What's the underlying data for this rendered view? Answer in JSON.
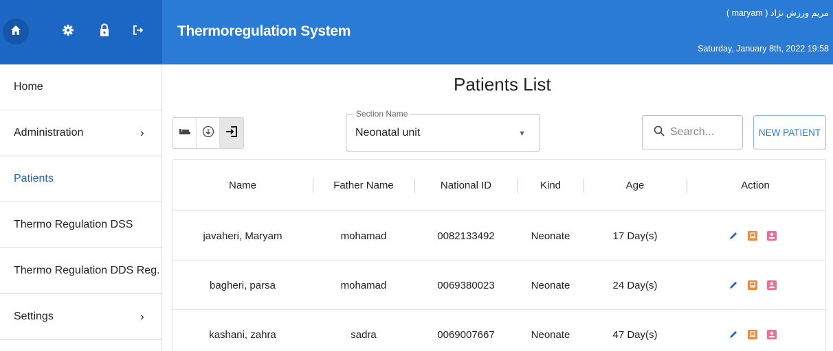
{
  "header": {
    "app_title": "Thermoregulation System",
    "user_name": "مریم ورزش نژاد ( maryam )",
    "date_time": "Saturday, January 8th, 2022 19:58",
    "icons": [
      "home-icon",
      "gear-icon",
      "lock-icon",
      "logout-icon"
    ]
  },
  "sidebar": {
    "items": [
      {
        "label": "Home",
        "has_submenu": false
      },
      {
        "label": "Administration",
        "has_submenu": true
      },
      {
        "label": "Patients",
        "has_submenu": false,
        "active": true
      },
      {
        "label": "Thermo Regulation DSS",
        "has_submenu": false
      },
      {
        "label": "Thermo Regulation DDS Reg.",
        "has_submenu": false
      },
      {
        "label": "Settings",
        "has_submenu": true
      }
    ],
    "chevron": "›"
  },
  "main": {
    "title": "Patients List",
    "toolbar": {
      "icons": [
        "bed-icon",
        "download-circle-icon",
        "login-arrow-icon"
      ]
    },
    "section": {
      "label": "Section Name",
      "value": "Neonatal unit"
    },
    "search": {
      "placeholder": "Search..."
    },
    "new_patient_label": "NEW PATIENT",
    "table": {
      "columns": [
        "Name",
        "Father Name",
        "National ID",
        "Kind",
        "Age",
        "Action"
      ],
      "rows": [
        {
          "name": "javaheri, Maryam",
          "father": "mohamad",
          "national_id": "0082133492",
          "kind": "Neonate",
          "age": "17 Day(s)"
        },
        {
          "name": "bagheri, parsa",
          "father": "mohamad",
          "national_id": "0069380023",
          "kind": "Neonate",
          "age": "24 Day(s)"
        },
        {
          "name": "kashani, zahra",
          "father": "sadra",
          "national_id": "0069007667",
          "kind": "Neonate",
          "age": "47 Day(s)"
        }
      ]
    }
  },
  "colors": {
    "header_blue": "#2a7bd6",
    "icon_bar_blue": "#1c67c4",
    "edit_icon": "#1c67c4",
    "print_icon": "#f08a3c",
    "profile_icon": "#f06b9a"
  }
}
